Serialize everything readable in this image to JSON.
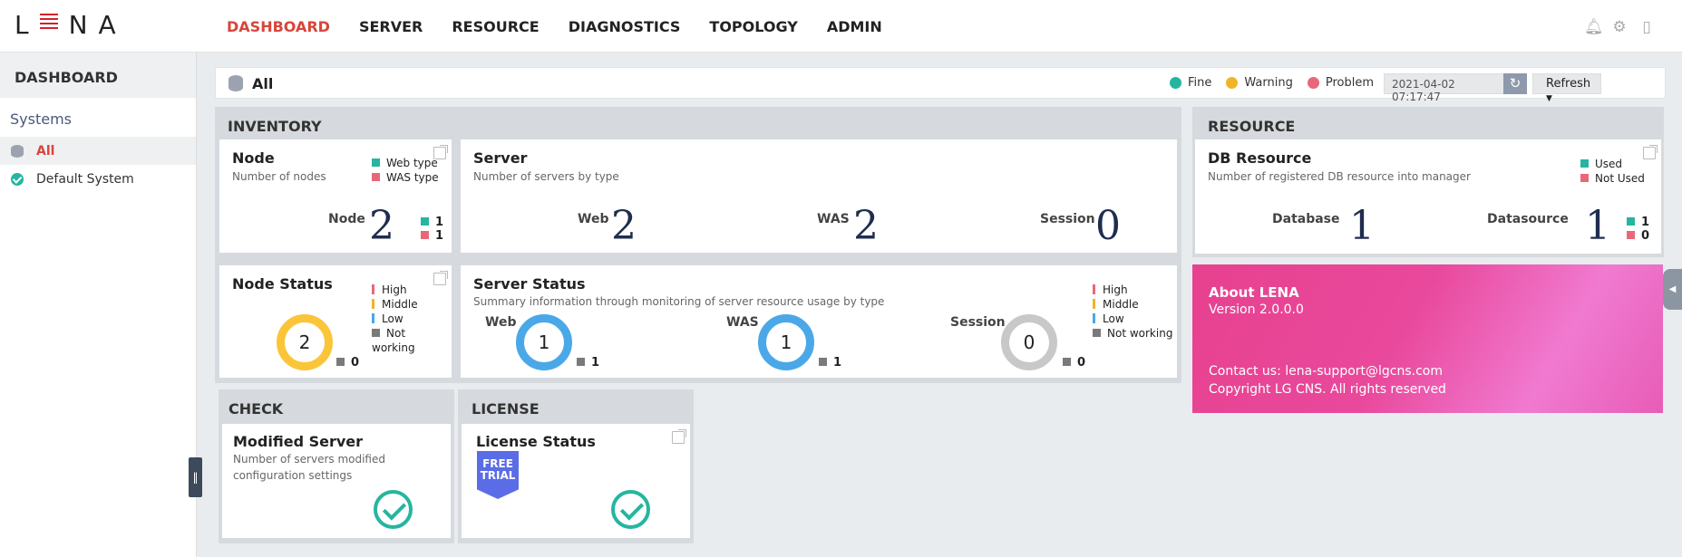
{
  "topbar": {
    "logo": "LENA",
    "nav": [
      "DASHBOARD",
      "SERVER",
      "RESOURCE",
      "DIAGNOSTICS",
      "TOPOLOGY",
      "ADMIN"
    ],
    "active_nav": "DASHBOARD",
    "icons": [
      "bell-icon",
      "gear-icon",
      "logout-icon"
    ]
  },
  "sidebar": {
    "title": "DASHBOARD",
    "section": "Systems",
    "items": [
      {
        "label": "All",
        "icon": "database-icon",
        "active": true
      },
      {
        "label": "Default System",
        "icon": "check-circle-icon",
        "active": false
      }
    ]
  },
  "crumb": {
    "title": "All",
    "legend": {
      "fine": "Fine",
      "warning": "Warning",
      "problem": "Problem"
    },
    "timestamp": "2021-04-02 07:17:47",
    "refresh_label": "Refresh"
  },
  "inventory": {
    "title": "INVENTORY",
    "node": {
      "title": "Node",
      "subtitle": "Number of nodes",
      "legend": [
        "Web type",
        "WAS type"
      ],
      "label": "Node",
      "value": "2",
      "web": "1",
      "was": "1"
    },
    "server": {
      "title": "Server",
      "subtitle": "Number of servers by type",
      "metrics": [
        {
          "label": "Web",
          "value": "2"
        },
        {
          "label": "WAS",
          "value": "2"
        },
        {
          "label": "Session",
          "value": "0"
        }
      ]
    },
    "node_status": {
      "title": "Node Status",
      "legend": [
        "High",
        "Middle",
        "Low",
        "Not working"
      ],
      "value": "2",
      "not_working": "0"
    },
    "server_status": {
      "title": "Server Status",
      "subtitle": "Summary information through monitoring of server resource usage by type",
      "legend": [
        "High",
        "Middle",
        "Low",
        "Not working"
      ],
      "metrics": [
        {
          "label": "Web",
          "value": "1",
          "not_working": "1"
        },
        {
          "label": "WAS",
          "value": "1",
          "not_working": "1"
        },
        {
          "label": "Session",
          "value": "0",
          "not_working": "0"
        }
      ]
    }
  },
  "check": {
    "title": "CHECK",
    "modified": {
      "title": "Modified Server",
      "subtitle": "Number of servers modified configuration settings"
    }
  },
  "license": {
    "title": "LICENSE",
    "status": {
      "title": "License Status",
      "badge_line1": "FREE",
      "badge_line2": "TRIAL"
    }
  },
  "resource": {
    "title": "RESOURCE",
    "db": {
      "title": "DB Resource",
      "subtitle": "Number of registered DB resource into manager",
      "legend": [
        "Used",
        "Not Used"
      ],
      "database_label": "Database",
      "database_value": "1",
      "datasource_label": "Datasource",
      "datasource_value": "1",
      "used": "1",
      "not_used": "0"
    }
  },
  "about": {
    "title": "About LENA",
    "version": "Version 2.0.0.0",
    "contact": "Contact us: lena-support@lgcns.com",
    "copyright": "Copyright LG CNS. All rights reserved"
  },
  "colors": {
    "accent": "#d9443a",
    "fine": "#26b5a0",
    "warning": "#f0b429",
    "problem": "#e8687a",
    "about_bg": "#e7418f"
  }
}
